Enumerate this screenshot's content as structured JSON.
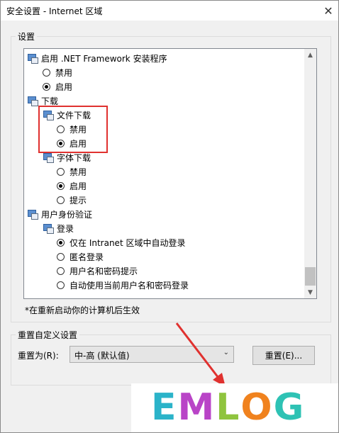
{
  "window": {
    "title": "安全设置 - Internet 区域",
    "close_glyph": "✕"
  },
  "settings": {
    "label": "设置",
    "items": [
      {
        "kind": "category",
        "text": "启用 .NET Framework 安装程序",
        "icon": "settings-category-icon"
      },
      {
        "kind": "radio",
        "text": "禁用",
        "selected": false
      },
      {
        "kind": "radio",
        "text": "启用",
        "selected": true
      },
      {
        "kind": "category",
        "text": "下载",
        "icon": "settings-category-icon"
      },
      {
        "kind": "category",
        "text": "文件下载",
        "icon": "settings-category-icon"
      },
      {
        "kind": "radio",
        "text": "禁用",
        "selected": false
      },
      {
        "kind": "radio",
        "text": "启用",
        "selected": true
      },
      {
        "kind": "category",
        "text": "字体下载",
        "icon": "settings-category-icon"
      },
      {
        "kind": "radio",
        "text": "禁用",
        "selected": false
      },
      {
        "kind": "radio",
        "text": "启用",
        "selected": true
      },
      {
        "kind": "radio",
        "text": "提示",
        "selected": false
      },
      {
        "kind": "category",
        "text": "用户身份验证",
        "icon": "users-icon"
      },
      {
        "kind": "category",
        "text": "登录",
        "icon": "users-icon"
      },
      {
        "kind": "radio",
        "text": "仅在 Intranet 区域中自动登录",
        "selected": true
      },
      {
        "kind": "radio",
        "text": "匿名登录",
        "selected": false
      },
      {
        "kind": "radio",
        "text": "用户名和密码提示",
        "selected": false
      },
      {
        "kind": "radio",
        "text": "自动使用当前用户名和密码登录",
        "selected": false
      }
    ],
    "note": "*在重新启动你的计算机后生效"
  },
  "reset": {
    "group_label": "重置自定义设置",
    "reset_to_label": "重置为(R):",
    "selected_level": "中-高 (默认值)",
    "button_label": "重置(E)..."
  },
  "watermark": {
    "letters": [
      {
        "char": "E",
        "color": "#2bb3c9"
      },
      {
        "char": "M",
        "color": "#b944c7"
      },
      {
        "char": "L",
        "color": "#8fc43e"
      },
      {
        "char": "O",
        "color": "#f0821e"
      },
      {
        "char": "G",
        "color": "#2ec2b4"
      }
    ]
  },
  "accent": {
    "highlight_box": "#e0312f",
    "arrow": "#e0312f"
  }
}
